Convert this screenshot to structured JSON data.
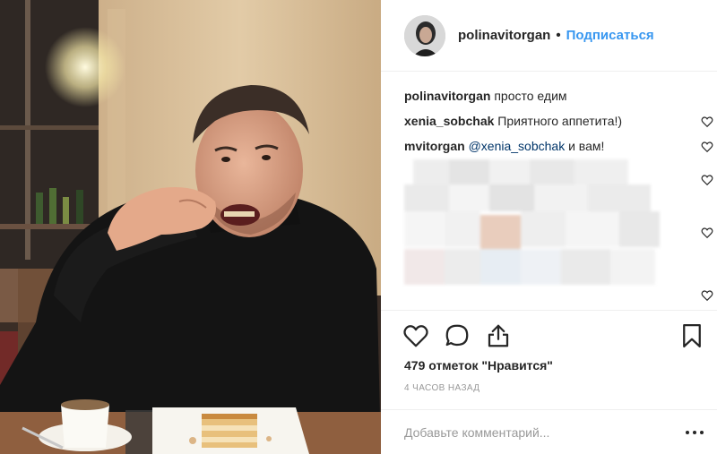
{
  "post": {
    "username": "polinavitorgan",
    "separator": "•",
    "follow_label": "Подписаться"
  },
  "comments": [
    {
      "user": "polinavitorgan",
      "text": " просто едим",
      "liked": false
    },
    {
      "user": "xenia_sobchak",
      "text": " Приятного аппетита!)",
      "liked": true
    },
    {
      "user": "mvitorgan",
      "mention": "@xenia_sobchak",
      "text": " и вам!",
      "liked": true
    }
  ],
  "icons": {
    "like": "heart-icon",
    "comment": "speech-bubble-icon",
    "share": "share-icon",
    "save": "bookmark-icon",
    "more": "ellipsis-icon",
    "comment_like": "heart-outline-icon"
  },
  "likes_text": "479 отметок \"Нравится\"",
  "timestamp": "4 ЧАСОВ НАЗАД",
  "comment_input": {
    "placeholder": "Добавьте комментарий...",
    "value": ""
  },
  "more_label": "...",
  "colors": {
    "link": "#3897f0",
    "mention": "#003569",
    "text": "#262626",
    "muted": "#999999",
    "divider": "#efefef"
  }
}
